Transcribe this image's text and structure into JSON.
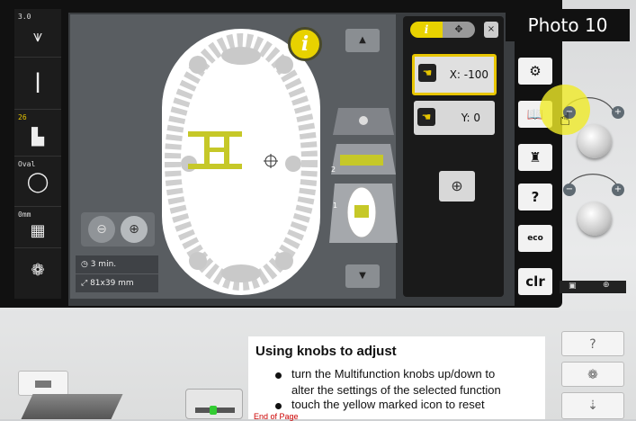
{
  "photo_label": "Photo 10",
  "left_strip": {
    "needle_size": "3.0",
    "stitch_count": "26",
    "hoop_label": "Oval",
    "thread_label": "0mm"
  },
  "embroidery": {
    "time": "3 min.",
    "size": "81x39 mm",
    "layer_1": "1",
    "layer_2": "2"
  },
  "panel": {
    "info_tab": "i",
    "close": "×",
    "x_value": "X: -100",
    "y_value": "Y: 0"
  },
  "right_buttons": {
    "clr": "clr",
    "eco": "eco",
    "help": "?"
  },
  "help": {
    "title": "Using knobs to adjust",
    "bullet1_line1": "turn the Multifunction knobs up/down to",
    "bullet1_line2": "alter the settings of the selected function",
    "bullet2_line1": "touch the yellow marked icon to reset",
    "end_of_page": "End of Page"
  },
  "side_buttons": {
    "question": "?"
  },
  "colors": {
    "accent": "#e8d200",
    "design": "#c6c828"
  }
}
